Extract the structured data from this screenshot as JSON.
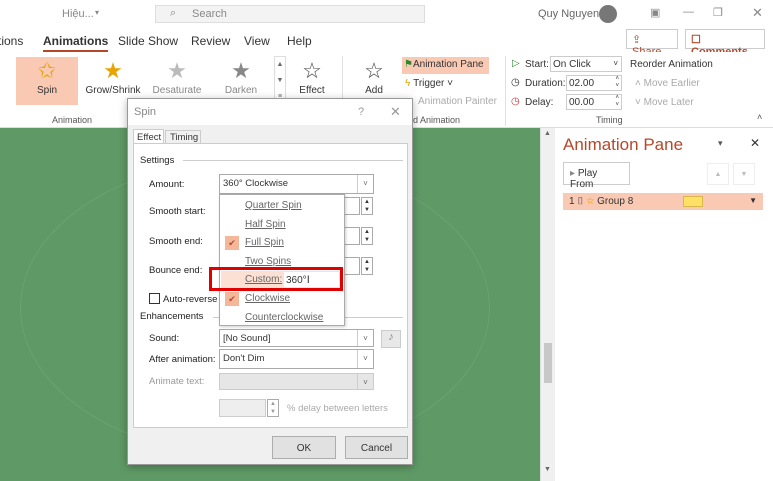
{
  "titlebar": {
    "doc_name": "Hiệu...",
    "search_placeholder": "Search",
    "user": "Quy Nguyen"
  },
  "tabs": [
    "tions",
    "Animations",
    "Slide Show",
    "Review",
    "View",
    "Help"
  ],
  "share": "Share",
  "comments": "Comments",
  "ribbon": {
    "gallery": [
      "Spin",
      "Grow/Shrink",
      "Desaturate",
      "Darken"
    ],
    "effect": "Effect",
    "group_animation": "Animation",
    "add": "Add",
    "animation_pane": "Animation Pane",
    "trigger": "Trigger",
    "painter": "Animation Painter",
    "group_adv": "d Animation",
    "start_label": "Start:",
    "start_value": "On Click",
    "duration_label": "Duration:",
    "duration_value": "02.00",
    "delay_label": "Delay:",
    "delay_value": "00.00",
    "reorder": "Reorder Animation",
    "earlier": "Move Earlier",
    "later": "Move Later",
    "group_timing": "Timing"
  },
  "pane": {
    "title": "Animation Pane",
    "play_from": "Play From",
    "item_num": "1",
    "item_name": "Group 8"
  },
  "dialog": {
    "title": "Spin",
    "help": "?",
    "tab_effect": "Effect",
    "tab_timing": "Timing",
    "settings": "Settings",
    "amount_label": "Amount:",
    "amount_value": "360° Clockwise",
    "smooth_start": "Smooth start:",
    "smooth_end": "Smooth end:",
    "bounce_end": "Bounce end:",
    "auto_reverse": "Auto-reverse",
    "options": [
      "Quarter Spin",
      "Half Spin",
      "Full Spin",
      "Two Spins",
      "Custom:",
      "Clockwise",
      "Counterclockwise"
    ],
    "custom_value": "360°",
    "enhancements": "Enhancements",
    "sound_label": "Sound:",
    "sound_value": "[No Sound]",
    "after_label": "After animation:",
    "after_value": "Don't Dim",
    "animate_text": "Animate text:",
    "delay_letters": "% delay between letters",
    "ok": "OK",
    "cancel": "Cancel"
  },
  "colors": {
    "accent": "#b7472a",
    "highlight": "#f9c9b4",
    "slide": "#5f9a66",
    "annotation": "#e00000"
  }
}
